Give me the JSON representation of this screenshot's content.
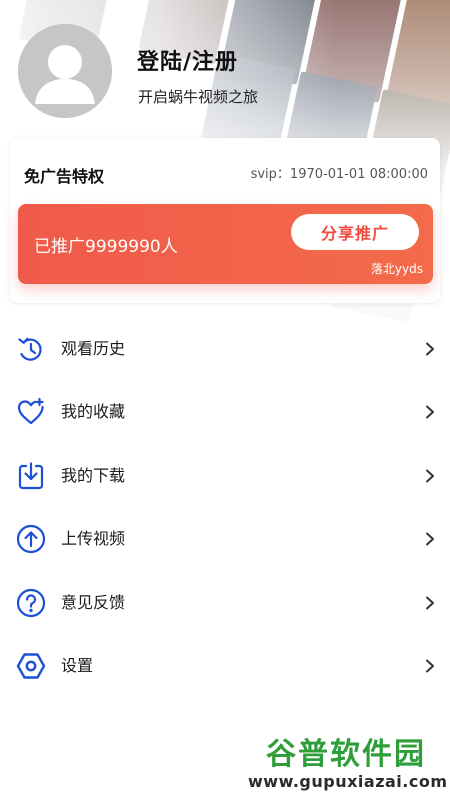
{
  "user": {
    "login_title": "登陆/注册",
    "login_subtitle": "开启蜗牛视频之旅"
  },
  "privilege": {
    "title": "免广告特权",
    "svip_text": "svip：1970-01-01 08:00:00",
    "promoted_text": "已推广9999990人",
    "share_button": "分享推广",
    "note": "落北yyds"
  },
  "menu": {
    "items": [
      {
        "label": "观看历史",
        "icon": "history-icon"
      },
      {
        "label": "我的收藏",
        "icon": "favorite-heart-icon"
      },
      {
        "label": "我的下载",
        "icon": "download-icon"
      },
      {
        "label": "上传视频",
        "icon": "upload-icon"
      },
      {
        "label": "意见反馈",
        "icon": "feedback-question-icon"
      },
      {
        "label": "设置",
        "icon": "settings-hexagon-icon"
      }
    ]
  },
  "watermark": {
    "brand": "谷普软件园",
    "url": "www.gupuxiazai.com"
  },
  "colors": {
    "accent_blue": "#1d4fd8",
    "promo_red": "#f05a4a",
    "share_text": "#ee4d3d",
    "watermark_green": "#2f9e3a"
  }
}
